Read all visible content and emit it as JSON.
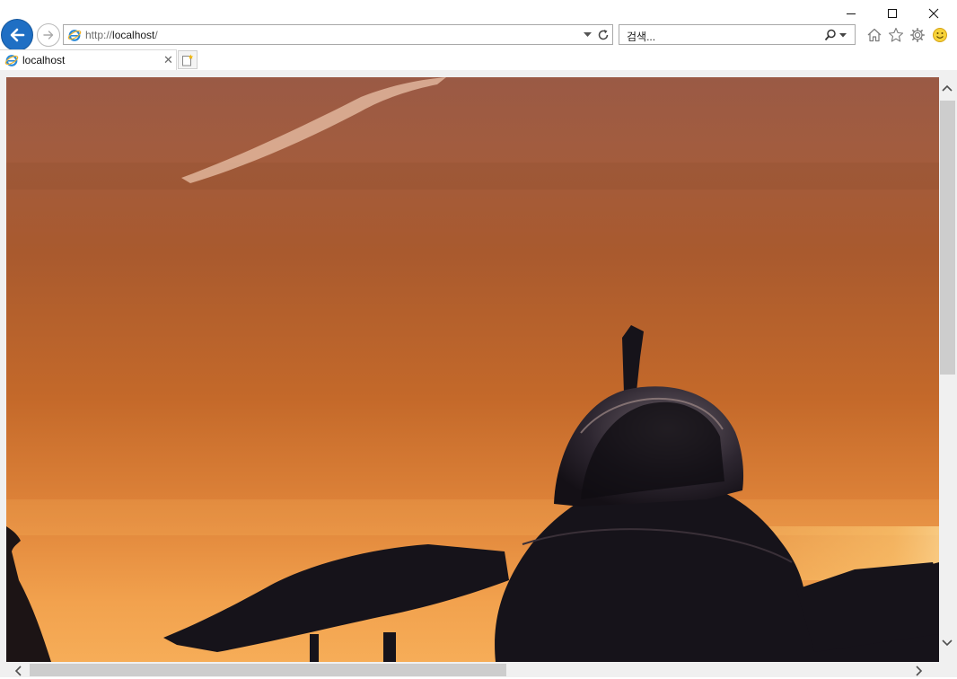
{
  "browser": {
    "address": {
      "scheme": "http://",
      "host": "localhost",
      "path": "/"
    },
    "search_placeholder": "검색...",
    "tab": {
      "title": "localhost"
    }
  },
  "page": {
    "image": {
      "subject": "fighter jet silhouette at sunset"
    }
  },
  "colors": {
    "back_button": "#1f6fc4",
    "sky_top": "#9a5a45",
    "sky_mid": "#c66a2a",
    "sky_bottom": "#f3a24a",
    "silhouette": "#15131a"
  },
  "icons": [
    "back-icon",
    "forward-icon",
    "ie-logo-icon",
    "dropdown-icon",
    "refresh-icon",
    "search-icon",
    "home-icon",
    "favorites-star-icon",
    "gear-icon",
    "smiley-feedback-icon",
    "close-icon",
    "new-tab-icon",
    "minimize-icon",
    "maximize-icon"
  ]
}
